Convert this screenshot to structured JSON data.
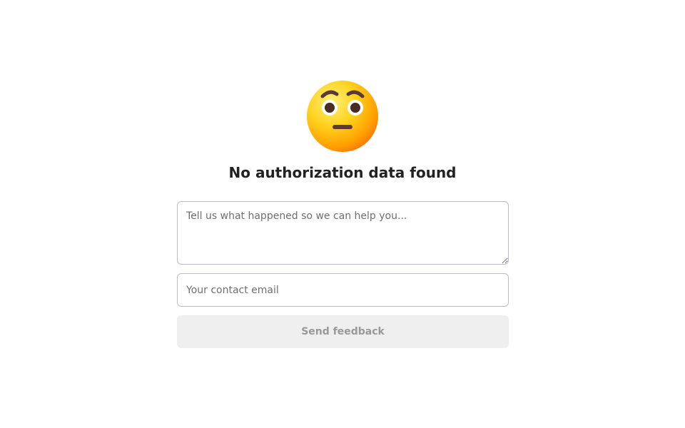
{
  "status": {
    "icon": "face-with-raised-eyebrows-icon",
    "title": "No authorization data found"
  },
  "feedback_form": {
    "message_value": "",
    "message_placeholder": "Tell us what happened so we can help you...",
    "email_value": "",
    "email_placeholder": "Your contact email",
    "submit_label": "Send feedback",
    "submit_disabled": true
  },
  "colors": {
    "face_light": "#ffe14a",
    "face_dark": "#ff8a00",
    "title_text": "#222222",
    "field_border": "#b8bccd",
    "button_bg_disabled": "#efefef",
    "button_text_disabled": "#999999"
  }
}
